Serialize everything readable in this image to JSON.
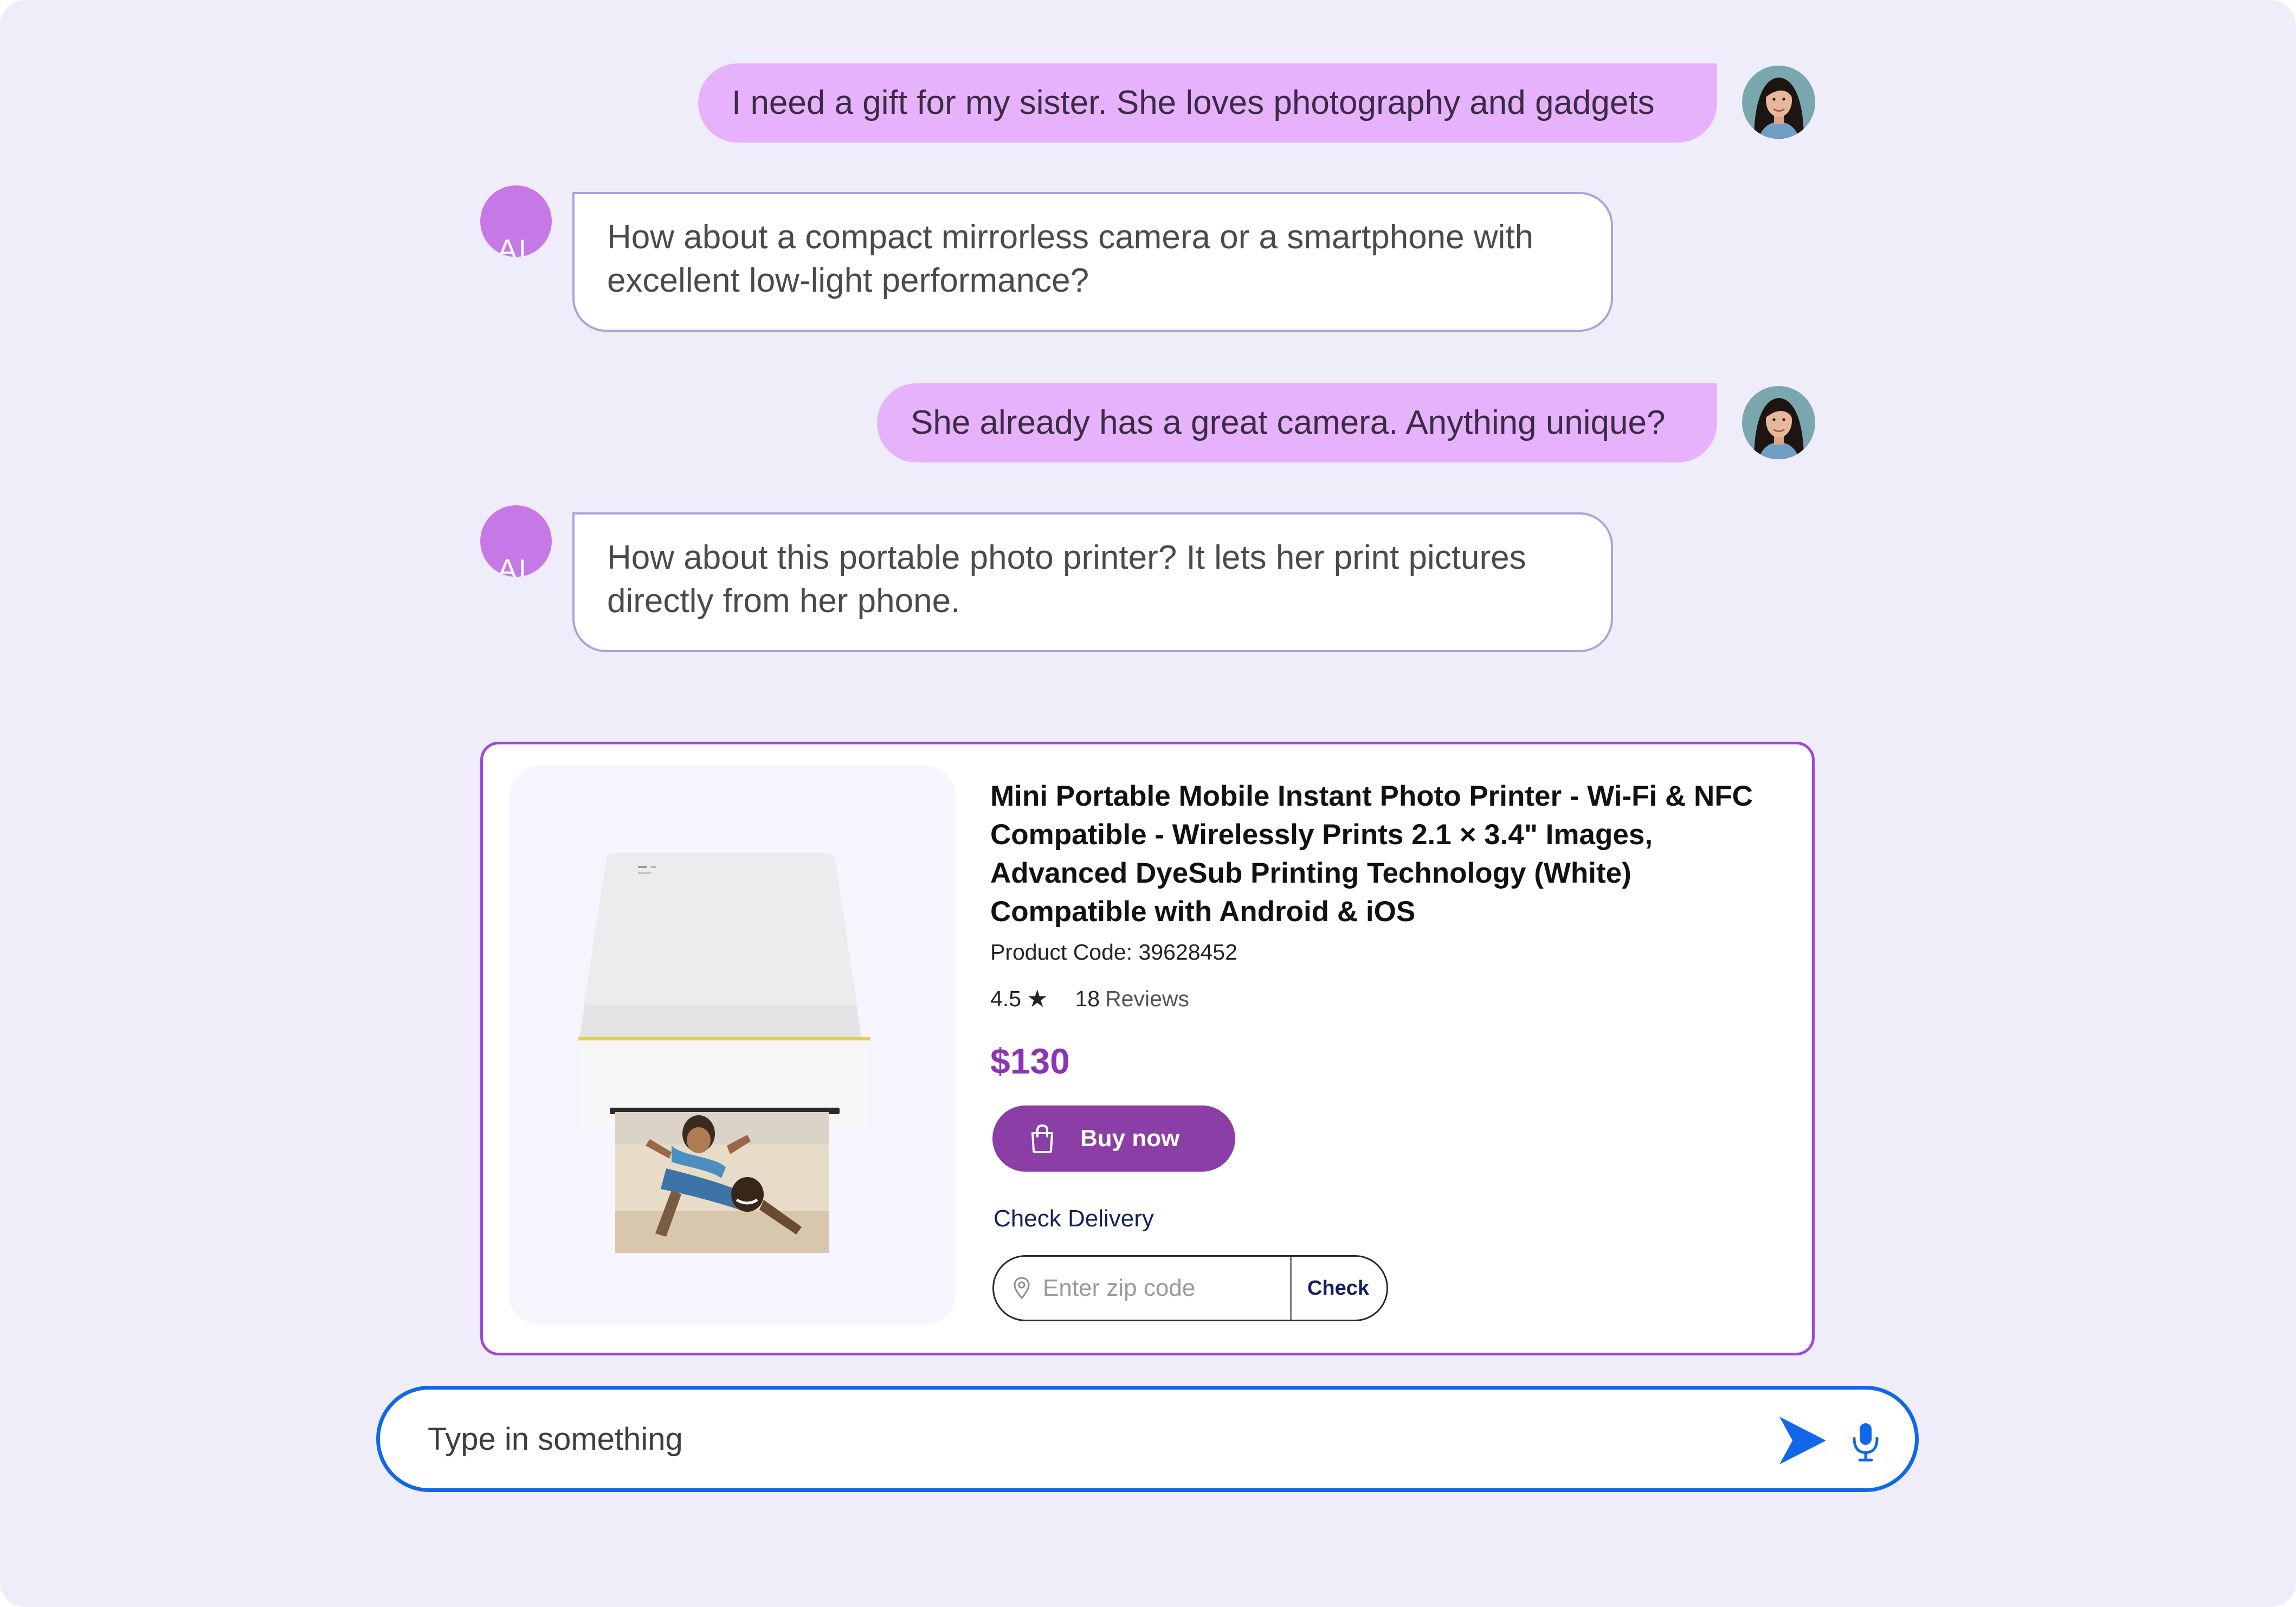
{
  "colors": {
    "background": "#eeedf9",
    "user_bubble": "#e6b2fb",
    "ai_avatar": "#c679e6",
    "ai_bubble_border": "#a6a6dc",
    "card_border": "#a046dc",
    "price": "#8a35b5",
    "buy_button": "#8a3ea6",
    "input_border": "#1167e8"
  },
  "messages": [
    {
      "role": "user",
      "text": "I need a gift for my sister. She loves photography and gadgets",
      "avatar_icon": "user-avatar"
    },
    {
      "role": "ai",
      "avatar_label": "AI",
      "lines": [
        "How about a compact mirrorless camera or a smartphone with",
        "excellent low-light performance?"
      ]
    },
    {
      "role": "user",
      "text": "She already has a great camera. Anything unique?",
      "avatar_icon": "user-avatar"
    },
    {
      "role": "ai",
      "avatar_label": "AI",
      "lines": [
        "How about this portable photo printer? It lets her print pictures",
        "directly from her phone."
      ]
    }
  ],
  "product": {
    "title_lines": [
      "Mini Portable Mobile Instant Photo Printer - Wi-Fi & NFC",
      "Compatible - Wirelessly Prints 2.1 × 3.4\" Images,",
      "Advanced DyeSub Printing Technology (White)",
      "Compatible with Android & iOS"
    ],
    "code_label": "Product Code: 39628452",
    "rating": "4.5",
    "rating_icon": "star-icon",
    "reviews_count": "18",
    "reviews_label": "Reviews",
    "price": "$130",
    "buy_label": "Buy now",
    "buy_icon": "shopping-bag-icon",
    "check_delivery_label": "Check Delivery",
    "zip_placeholder": "Enter zip code",
    "zip_icon": "location-pin-icon",
    "check_label": "Check",
    "image_icon": "photo-printer-image"
  },
  "composer": {
    "placeholder": "Type in something",
    "send_icon": "send-icon",
    "mic_icon": "microphone-icon"
  }
}
